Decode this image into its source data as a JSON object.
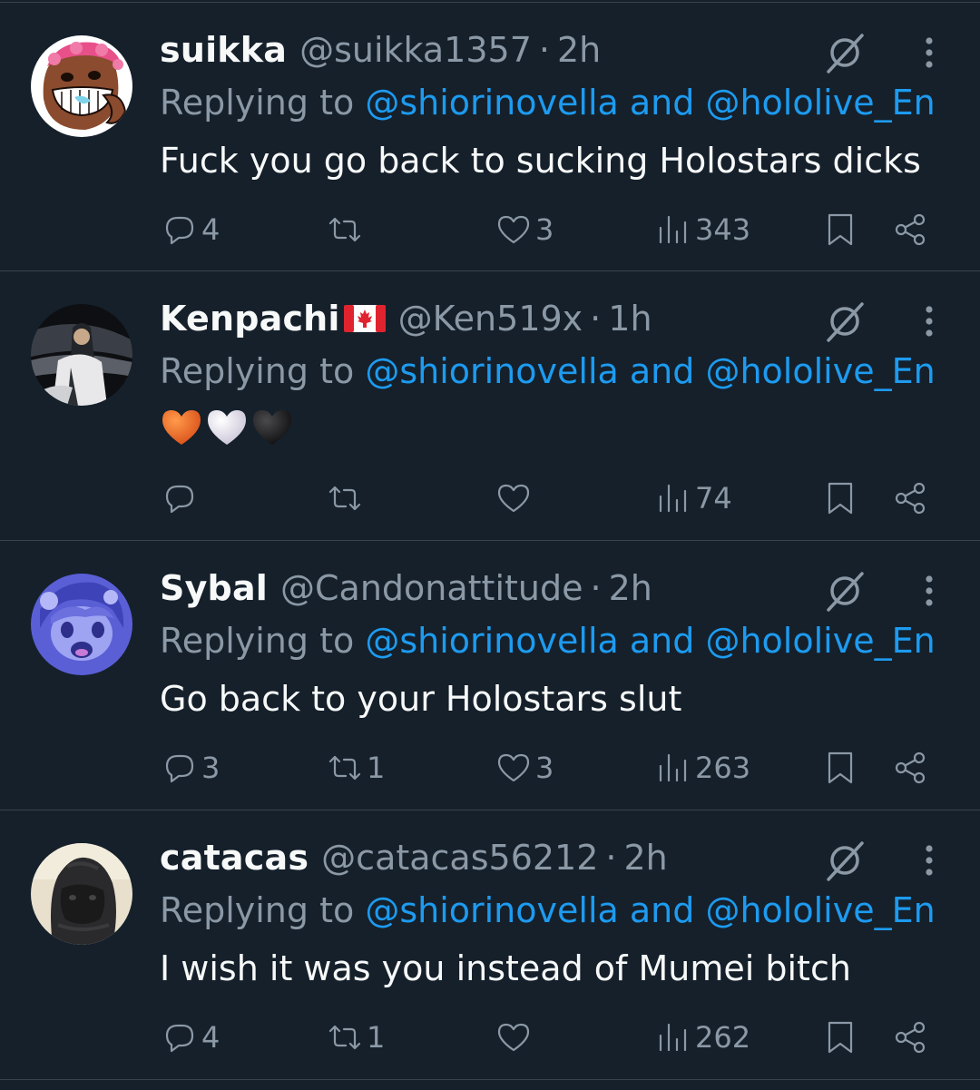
{
  "replying_prefix": "Replying to ",
  "separator": "·",
  "tweets": [
    {
      "name": "suikka",
      "handle": "@suikka1357",
      "time": "2h",
      "mentions": [
        "@shiorinovella",
        "@hololive_En"
      ],
      "mention_joiner": " and ",
      "text": "Fuck you go back to sucking Holostars dicks",
      "replies": "4",
      "reposts": "",
      "likes": "3",
      "views": "343",
      "avatar_icon": "cartoon-face-avatar"
    },
    {
      "name": "Kenpachi",
      "flag": "canada-flag",
      "handle": "@Ken519x",
      "time": "1h",
      "mentions": [
        "@shiorinovella",
        "@hololive_En"
      ],
      "mention_joiner": " and ",
      "emojis": [
        "orange-heart",
        "white-heart",
        "black-heart"
      ],
      "replies": "",
      "reposts": "",
      "likes": "",
      "views": "74",
      "avatar_icon": "anime-character-avatar"
    },
    {
      "name": "Sybal",
      "handle": "@Candonattitude",
      "time": "2h",
      "mentions": [
        "@shiorinovella",
        "@hololive_En"
      ],
      "mention_joiner": " and ",
      "text": "Go back to your Holostars slut",
      "replies": "3",
      "reposts": "1",
      "likes": "3",
      "views": "263",
      "avatar_icon": "anime-girl-avatar"
    },
    {
      "name": "catacas",
      "handle": "@catacas56212",
      "time": "2h",
      "mentions": [
        "@shiorinovella",
        "@hololive_En"
      ],
      "mention_joiner": " and ",
      "text": "I wish it was you instead of Mumei bitch",
      "replies": "4",
      "reposts": "1",
      "likes": "",
      "views": "262",
      "avatar_icon": "gorilla-avatar"
    }
  ],
  "colors": {
    "background": "#15202b",
    "divider": "#38444d",
    "muted": "#8b98a5",
    "link": "#1d9bf0",
    "text": "#f7f9f9"
  }
}
